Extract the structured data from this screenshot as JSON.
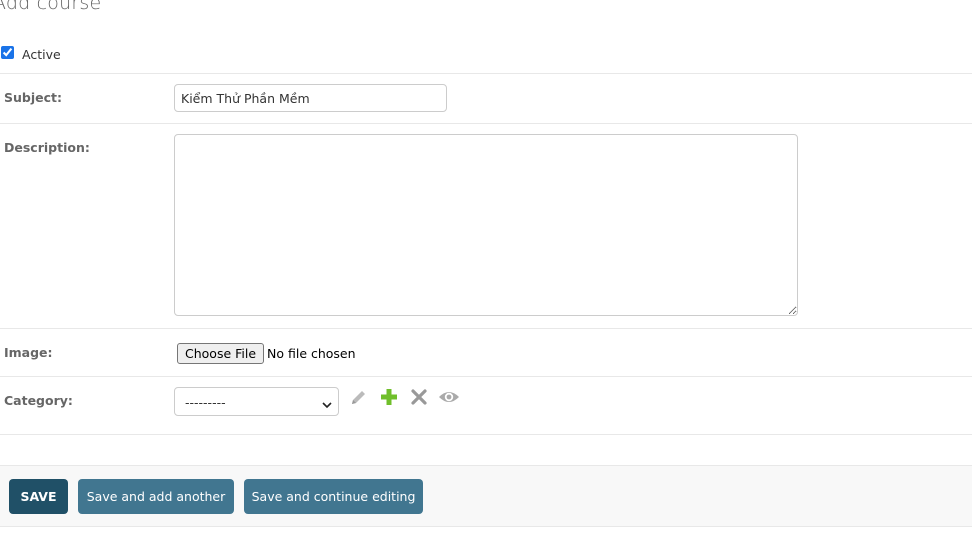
{
  "page": {
    "title": "Add course"
  },
  "form": {
    "active": {
      "label": "Active",
      "checked": true
    },
    "subject": {
      "label": "Subject:",
      "value": "Kiểm Thử Phần Mềm"
    },
    "description": {
      "label": "Description:",
      "value": ""
    },
    "image": {
      "label": "Image:",
      "button_label": "Choose File",
      "status": "No file chosen"
    },
    "category": {
      "label": "Category:",
      "selected": "---------",
      "actions": [
        "pencil-icon",
        "plus-icon",
        "close-icon",
        "eye-icon"
      ]
    }
  },
  "submit": {
    "save_label": "SAVE",
    "save_add_label": "Save and add another",
    "save_continue_label": "Save and continue editing"
  },
  "colors": {
    "primary_button": "#205067",
    "secondary_button": "#417690",
    "add_icon": "#70bf2b",
    "muted_icon": "#aaaaaa"
  }
}
